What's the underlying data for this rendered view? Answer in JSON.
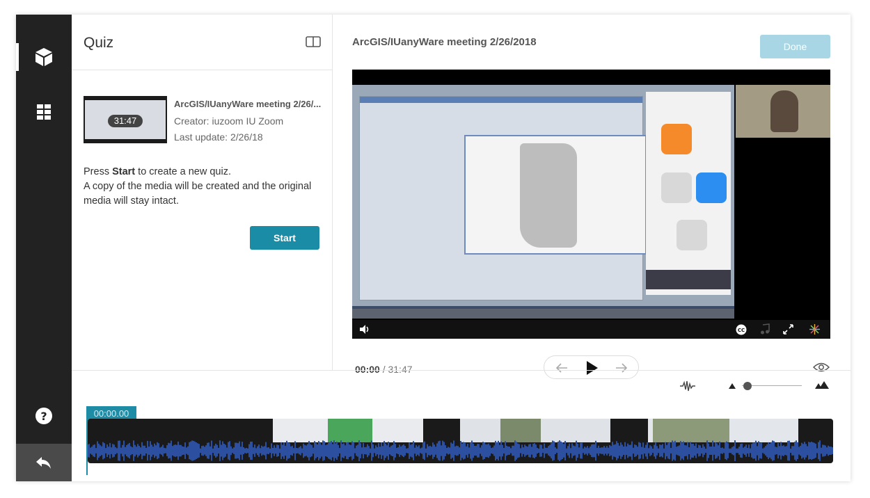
{
  "sidebar": {
    "items": [
      {
        "icon": "cube-icon"
      },
      {
        "icon": "chapters-icon"
      }
    ],
    "help_icon": "question-circle-icon",
    "back_icon": "undo-arrow-icon"
  },
  "quiz": {
    "title": "Quiz",
    "entry": {
      "title": "ArcGIS/IUanyWare meeting 2/26/...",
      "duration": "31:47",
      "creator": "Creator: iuzoom IU Zoom",
      "last_update": "Last update: 2/26/18"
    },
    "instructions": {
      "pre": "Press ",
      "bold": "Start",
      "post": " to create a new quiz.",
      "line2": "A copy of the media will be created and the original media will stay intact."
    },
    "start_label": "Start"
  },
  "player": {
    "title": "ArcGIS/IUanyWare meeting 2/26/2018",
    "done_label": "Done",
    "current_time": "00:00",
    "separator": "/",
    "total_time": "31:47"
  },
  "timeline": {
    "timecode": "00:00.00"
  },
  "colors": {
    "accent": "#1b8ca6",
    "done_disabled": "#a8d6e5",
    "sidebar": "#222222",
    "waveform": "#2c4fa0"
  }
}
